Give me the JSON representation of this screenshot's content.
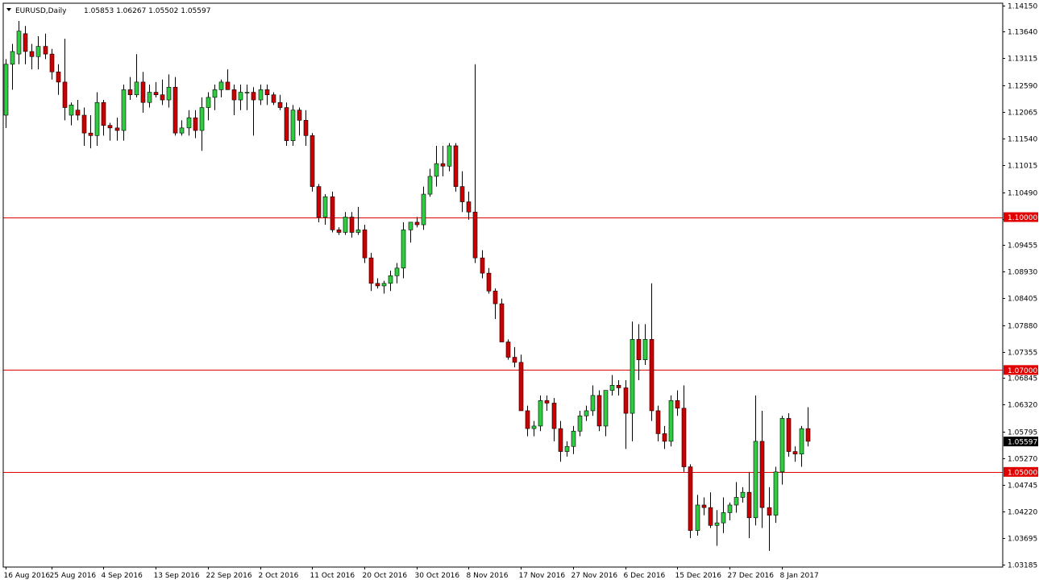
{
  "header": {
    "symbol": "EURUSD,Daily",
    "ohlc": "1.05853 1.06267 1.05502 1.05597"
  },
  "colors": {
    "bull": "#2ecc40",
    "bear": "#cc0000",
    "wick": "#000000",
    "hline": "#e00000",
    "hline_label_bg": "#e00000",
    "current_label_bg": "#000000"
  },
  "chart_data": {
    "type": "candlestick",
    "title": "EURUSD,Daily",
    "ylim": [
      1.0318,
      1.1415
    ],
    "y_ticks": [
      "1.14150",
      "1.13640",
      "1.13115",
      "1.12590",
      "1.12065",
      "1.11540",
      "1.11015",
      "1.10490",
      "1.09955",
      "1.09455",
      "1.08930",
      "1.08405",
      "1.07880",
      "1.07355",
      "1.06845",
      "1.06320",
      "1.05795",
      "1.05270",
      "1.04745",
      "1.04220",
      "1.03695",
      "1.03185"
    ],
    "x_labels": [
      {
        "label": "16 Aug 2016",
        "index": 0
      },
      {
        "label": "25 Aug 2016",
        "index": 7
      },
      {
        "label": "4 Sep 2016",
        "index": 15
      },
      {
        "label": "13 Sep 2016",
        "index": 23
      },
      {
        "label": "22 Sep 2016",
        "index": 31
      },
      {
        "label": "2 Oct 2016",
        "index": 39
      },
      {
        "label": "11 Oct 2016",
        "index": 47
      },
      {
        "label": "20 Oct 2016",
        "index": 55
      },
      {
        "label": "30 Oct 2016",
        "index": 63
      },
      {
        "label": "8 Nov 2016",
        "index": 71
      },
      {
        "label": "17 Nov 2016",
        "index": 79
      },
      {
        "label": "27 Nov 2016",
        "index": 87
      },
      {
        "label": "6 Dec 2016",
        "index": 95
      },
      {
        "label": "15 Dec 2016",
        "index": 103
      },
      {
        "label": "27 Dec 2016",
        "index": 111
      },
      {
        "label": "8 Jan 2017",
        "index": 119
      }
    ],
    "horizontal_lines": [
      {
        "value": 1.1,
        "label": "1.10000"
      },
      {
        "value": 1.07,
        "label": "1.07000"
      },
      {
        "value": 1.05,
        "label": "1.05000"
      }
    ],
    "current_price": {
      "value": 1.05597,
      "label": "1.05597"
    },
    "candles": [
      [
        1.12,
        1.131,
        1.1175,
        1.13
      ],
      [
        1.13,
        1.134,
        1.125,
        1.1325
      ],
      [
        1.132,
        1.1385,
        1.13,
        1.1365
      ],
      [
        1.136,
        1.1375,
        1.13,
        1.1325
      ],
      [
        1.1325,
        1.134,
        1.129,
        1.1315
      ],
      [
        1.1315,
        1.1355,
        1.129,
        1.1335
      ],
      [
        1.1335,
        1.136,
        1.131,
        1.132
      ],
      [
        1.132,
        1.133,
        1.127,
        1.1285
      ],
      [
        1.1285,
        1.13,
        1.124,
        1.1265
      ],
      [
        1.1265,
        1.135,
        1.119,
        1.1215
      ],
      [
        1.12,
        1.1225,
        1.118,
        1.122
      ],
      [
        1.121,
        1.123,
        1.119,
        1.12
      ],
      [
        1.12,
        1.1215,
        1.114,
        1.1165
      ],
      [
        1.1165,
        1.12,
        1.1135,
        1.116
      ],
      [
        1.116,
        1.1245,
        1.114,
        1.1225
      ],
      [
        1.1225,
        1.123,
        1.116,
        1.118
      ],
      [
        1.118,
        1.1185,
        1.115,
        1.1175
      ],
      [
        1.1175,
        1.1195,
        1.115,
        1.117
      ],
      [
        1.117,
        1.126,
        1.115,
        1.125
      ],
      [
        1.125,
        1.1275,
        1.123,
        1.124
      ],
      [
        1.124,
        1.132,
        1.1235,
        1.1265
      ],
      [
        1.1265,
        1.1285,
        1.1205,
        1.1225
      ],
      [
        1.1225,
        1.126,
        1.1215,
        1.1245
      ],
      [
        1.1245,
        1.1265,
        1.1235,
        1.124
      ],
      [
        1.124,
        1.127,
        1.122,
        1.123
      ],
      [
        1.123,
        1.128,
        1.1215,
        1.1255
      ],
      [
        1.1255,
        1.1275,
        1.116,
        1.1165
      ],
      [
        1.1165,
        1.119,
        1.116,
        1.1175
      ],
      [
        1.1175,
        1.121,
        1.116,
        1.1195
      ],
      [
        1.1195,
        1.121,
        1.1155,
        1.117
      ],
      [
        1.117,
        1.1235,
        1.113,
        1.1215
      ],
      [
        1.1215,
        1.1245,
        1.119,
        1.1235
      ],
      [
        1.1235,
        1.126,
        1.121,
        1.125
      ],
      [
        1.125,
        1.127,
        1.1235,
        1.1265
      ],
      [
        1.1265,
        1.129,
        1.125,
        1.125
      ],
      [
        1.125,
        1.126,
        1.12,
        1.123
      ],
      [
        1.123,
        1.126,
        1.121,
        1.1245
      ],
      [
        1.1245,
        1.126,
        1.121,
        1.1245
      ],
      [
        1.1245,
        1.1255,
        1.116,
        1.123
      ],
      [
        1.123,
        1.126,
        1.122,
        1.125
      ],
      [
        1.125,
        1.126,
        1.122,
        1.124
      ],
      [
        1.124,
        1.1245,
        1.122,
        1.1225
      ],
      [
        1.1225,
        1.124,
        1.121,
        1.1215
      ],
      [
        1.1215,
        1.1225,
        1.114,
        1.115
      ],
      [
        1.115,
        1.122,
        1.114,
        1.121
      ],
      [
        1.121,
        1.1215,
        1.116,
        1.119
      ],
      [
        1.119,
        1.121,
        1.114,
        1.116
      ],
      [
        1.116,
        1.1165,
        1.105,
        1.106
      ],
      [
        1.106,
        1.1065,
        1.099,
        1.1
      ],
      [
        1.1,
        1.1045,
        1.0985,
        1.104
      ],
      [
        1.104,
        1.105,
        1.097,
        1.0975
      ],
      [
        1.0975,
        1.098,
        1.0965,
        1.097
      ],
      [
        1.097,
        1.101,
        1.0965,
        1.1
      ],
      [
        1.1,
        1.101,
        1.096,
        1.097
      ],
      [
        1.097,
        1.102,
        1.0965,
        1.0975
      ],
      [
        1.0975,
        1.0985,
        1.091,
        1.092
      ],
      [
        1.092,
        1.093,
        1.0855,
        1.087
      ],
      [
        1.087,
        1.088,
        1.086,
        1.0865
      ],
      [
        1.0865,
        1.0875,
        1.085,
        1.087
      ],
      [
        1.087,
        1.0895,
        1.0855,
        1.0885
      ],
      [
        1.0885,
        1.091,
        1.087,
        1.09
      ],
      [
        1.09,
        1.099,
        1.088,
        1.0975
      ],
      [
        1.0975,
        1.099,
        1.095,
        1.099
      ],
      [
        1.099,
        1.1,
        1.098,
        1.0985
      ],
      [
        1.0985,
        1.106,
        1.0975,
        1.1045
      ],
      [
        1.1045,
        1.1095,
        1.104,
        1.108
      ],
      [
        1.108,
        1.114,
        1.106,
        1.1105
      ],
      [
        1.1105,
        1.114,
        1.108,
        1.11
      ],
      [
        1.11,
        1.1145,
        1.109,
        1.114
      ],
      [
        1.114,
        1.1145,
        1.105,
        1.106
      ],
      [
        1.106,
        1.109,
        1.101,
        1.103
      ],
      [
        1.103,
        1.105,
        1.0995,
        1.101
      ],
      [
        1.101,
        1.13,
        1.091,
        1.092
      ],
      [
        1.092,
        1.0935,
        1.088,
        1.089
      ],
      [
        1.089,
        1.09,
        1.085,
        1.0855
      ],
      [
        1.0855,
        1.086,
        1.08,
        1.083
      ],
      [
        1.083,
        1.084,
        1.076,
        1.0755
      ],
      [
        1.0755,
        1.076,
        1.072,
        1.0725
      ],
      [
        1.0725,
        1.0745,
        1.0705,
        1.0715
      ],
      [
        1.0715,
        1.073,
        1.064,
        1.062
      ],
      [
        1.062,
        1.063,
        1.057,
        1.0585
      ],
      [
        1.0585,
        1.06,
        1.057,
        1.059
      ],
      [
        1.059,
        1.065,
        1.058,
        1.064
      ],
      [
        1.064,
        1.065,
        1.062,
        1.0635
      ],
      [
        1.0635,
        1.0645,
        1.056,
        1.0585
      ],
      [
        1.0585,
        1.06,
        1.052,
        1.054
      ],
      [
        1.054,
        1.056,
        1.053,
        1.055
      ],
      [
        1.055,
        1.059,
        1.0535,
        1.058
      ],
      [
        1.058,
        1.062,
        1.057,
        1.061
      ],
      [
        1.061,
        1.063,
        1.06,
        1.062
      ],
      [
        1.062,
        1.067,
        1.061,
        1.065
      ],
      [
        1.065,
        1.066,
        1.058,
        1.059
      ],
      [
        1.059,
        1.066,
        1.057,
        1.066
      ],
      [
        1.066,
        1.069,
        1.065,
        1.067
      ],
      [
        1.067,
        1.068,
        1.065,
        1.0665
      ],
      [
        1.0665,
        1.068,
        1.0545,
        1.0615
      ],
      [
        1.0615,
        1.0795,
        1.056,
        1.076
      ],
      [
        1.076,
        1.079,
        1.068,
        1.072
      ],
      [
        1.072,
        1.079,
        1.071,
        1.076
      ],
      [
        1.076,
        1.087,
        1.06,
        1.062
      ],
      [
        1.062,
        1.063,
        1.056,
        1.0575
      ],
      [
        1.0575,
        1.059,
        1.0545,
        1.056
      ],
      [
        1.056,
        1.065,
        1.055,
        1.064
      ],
      [
        1.064,
        1.066,
        1.061,
        1.0625
      ],
      [
        1.0625,
        1.067,
        1.05,
        1.051
      ],
      [
        1.051,
        1.0515,
        1.037,
        1.0385
      ],
      [
        1.0385,
        1.0455,
        1.0375,
        1.0435
      ],
      [
        1.0435,
        1.045,
        1.0415,
        1.043
      ],
      [
        1.043,
        1.046,
        1.039,
        1.0395
      ],
      [
        1.0395,
        1.0425,
        1.0355,
        1.04
      ],
      [
        1.04,
        1.045,
        1.038,
        1.042
      ],
      [
        1.042,
        1.044,
        1.0405,
        1.0435
      ],
      [
        1.0435,
        1.048,
        1.042,
        1.045
      ],
      [
        1.045,
        1.047,
        1.044,
        1.046
      ],
      [
        1.046,
        1.05,
        1.037,
        1.041
      ],
      [
        1.041,
        1.065,
        1.0395,
        1.056
      ],
      [
        1.056,
        1.062,
        1.039,
        1.043
      ],
      [
        1.043,
        1.047,
        1.0345,
        1.0415
      ],
      [
        1.0415,
        1.051,
        1.04,
        1.05
      ],
      [
        1.05,
        1.061,
        1.0475,
        1.0605
      ],
      [
        1.0605,
        1.0615,
        1.053,
        1.054
      ],
      [
        1.054,
        1.055,
        1.052,
        1.0535
      ],
      [
        1.0535,
        1.059,
        1.051,
        1.0585
      ],
      [
        1.0585,
        1.0627,
        1.055,
        1.056
      ]
    ]
  }
}
